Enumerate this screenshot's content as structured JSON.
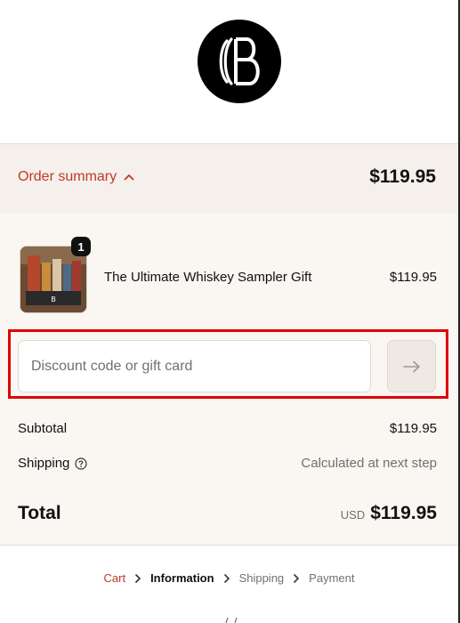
{
  "logo": {
    "icon": "brand-logo-icon",
    "color": "#000000"
  },
  "order_summary": {
    "toggle_label": "Order summary",
    "toggle_icon": "chevron-up-icon",
    "total": "$119.95",
    "accent_color": "#c0392b"
  },
  "line_items": [
    {
      "name": "The Ultimate Whiskey Sampler Gift",
      "price": "$119.95",
      "quantity": "1"
    }
  ],
  "discount": {
    "placeholder": "Discount code or gift card",
    "value": "",
    "apply_icon": "arrow-right-icon"
  },
  "totals": {
    "subtotal_label": "Subtotal",
    "subtotal_value": "$119.95",
    "shipping_label": "Shipping",
    "shipping_help_icon": "question-circle-icon",
    "shipping_value": "Calculated at next step",
    "total_label": "Total",
    "currency": "USD",
    "total_value": "$119.95"
  },
  "breadcrumb": {
    "items": [
      {
        "label": "Cart",
        "state": "link"
      },
      {
        "label": "Information",
        "state": "current"
      },
      {
        "label": "Shipping",
        "state": "upcoming"
      },
      {
        "label": "Payment",
        "state": "upcoming"
      }
    ],
    "separator_icon": "chevron-right-icon"
  }
}
